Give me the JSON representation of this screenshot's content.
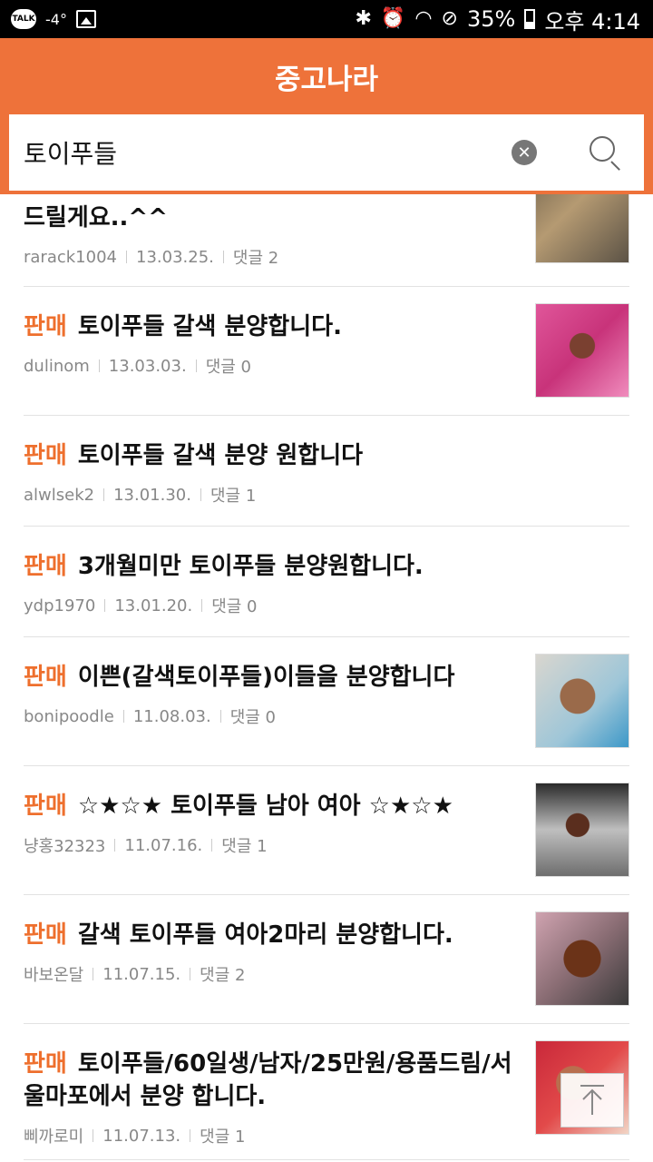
{
  "status_bar": {
    "talk_badge": "TALK",
    "temperature": "-4°",
    "battery": "35%",
    "time": "오후 4:14"
  },
  "header": {
    "title": "중고나라"
  },
  "search": {
    "value": "토이푸들"
  },
  "items": [
    {
      "prefix": "",
      "title": "드릴게요..^^",
      "author": "rarack1004",
      "date": "13.03.25.",
      "comments": "댓글 2",
      "thumb": "sofa"
    },
    {
      "prefix": "판매",
      "title": "토이푸들 갈색 분양합니다.",
      "author": "dulinom",
      "date": "13.03.03.",
      "comments": "댓글 0",
      "thumb": "pink"
    },
    {
      "prefix": "판매",
      "title": "토이푸들 갈색 분양 원합니다",
      "author": "alwlsek2",
      "date": "13.01.30.",
      "comments": "댓글 1",
      "thumb": ""
    },
    {
      "prefix": "판매",
      "title": "3개월미만 토이푸들 분양원합니다.",
      "author": "ydp1970",
      "date": "13.01.20.",
      "comments": "댓글 0",
      "thumb": ""
    },
    {
      "prefix": "판매",
      "title": "이쁜(갈색토이푸들)이들을 분양합니다",
      "author": "bonipoodle",
      "date": "11.08.03.",
      "comments": "댓글 0",
      "thumb": "blue"
    },
    {
      "prefix": "판매",
      "title": "☆★☆★ 토이푸들 남아 여아 ☆★☆★",
      "author": "냥홍32323",
      "date": "11.07.16.",
      "comments": "댓글 1",
      "thumb": "lap"
    },
    {
      "prefix": "판매",
      "title": "갈색 토이푸들 여아2마리 분양합니다.",
      "author": "바보온달",
      "date": "11.07.15.",
      "comments": "댓글 2",
      "thumb": "standing"
    },
    {
      "prefix": "판매",
      "title": "토이푸들/60일생/남자/25만원/용품드림/서울마포에서 분양 합니다.",
      "author": "삐까로미",
      "date": "11.07.13.",
      "comments": "댓글 1",
      "thumb": "red"
    }
  ]
}
